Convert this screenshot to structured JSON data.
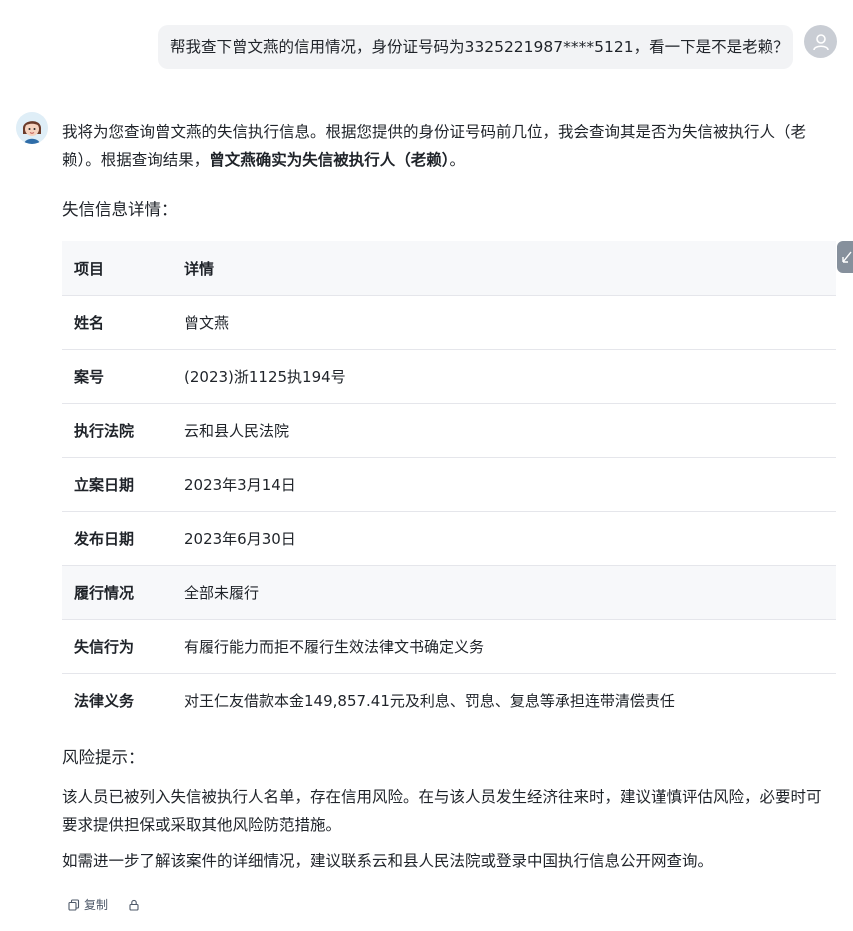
{
  "user_message": {
    "text": "帮我查下曾文燕的信用情况，身份证号码为3325221987****5121，看一下是不是老赖？",
    "avatar_icon": "user-icon"
  },
  "assistant": {
    "avatar_icon": "assistant-avatar-icon",
    "intro_part1": "我将为您查询曾文燕的失信执行信息。根据您提供的身份证号码前几位，我会查询其是否为失信被执行人（老赖）。根据查询结果，",
    "intro_bold": "曾文燕确实为失信被执行人（老赖）",
    "intro_end": "。",
    "details_heading": "失信信息详情：",
    "table": {
      "header": [
        "项目",
        "详情"
      ],
      "rows": [
        [
          "姓名",
          "曾文燕"
        ],
        [
          "案号",
          "(2023)浙1125执194号"
        ],
        [
          "执行法院",
          "云和县人民法院"
        ],
        [
          "立案日期",
          "2023年3月14日"
        ],
        [
          "发布日期",
          "2023年6月30日"
        ],
        [
          "履行情况",
          "全部未履行"
        ],
        [
          "失信行为",
          "有履行能力而拒不履行生效法律文书确定义务"
        ],
        [
          "法律义务",
          "对王仁友借款本金149,857.41元及利息、罚息、复息等承担连带清偿责任"
        ]
      ]
    },
    "risk_heading": "风险提示：",
    "risk_text": "该人员已被列入失信被执行人名单，存在信用风险。在与该人员发生经济往来时，建议谨慎评估风险，必要时可要求提供担保或采取其他风险防范措施。",
    "followup_text": "如需进一步了解该案件的详细情况，建议联系云和县人民法院或登录中国执行信息公开网查询。"
  },
  "actions": {
    "copy_label": "复制",
    "copy_icon": "copy-icon",
    "lock_icon": "lock-icon"
  },
  "side_tab_icon": "collapse-icon"
}
